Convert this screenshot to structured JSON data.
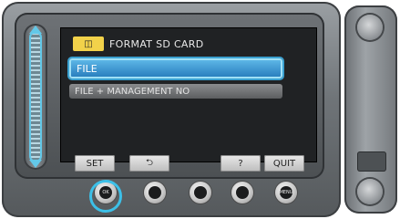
{
  "menu": {
    "title": "FORMAT SD CARD",
    "title_icon": "card-menu-icon",
    "items": [
      {
        "label": "FILE",
        "selected": true
      },
      {
        "label": "FILE + MANAGEMENT NO",
        "selected": false
      }
    ]
  },
  "softkeys": [
    {
      "label": "SET"
    },
    {
      "label": "⮌"
    },
    {
      "label": "?"
    },
    {
      "label": "QUIT"
    }
  ],
  "buttons": {
    "ok_label": "OK",
    "menu_label": "MENU"
  },
  "colors": {
    "highlight": "#3aa0cf",
    "title_icon_bg": "#f2d24a",
    "screen_bg": "#202224"
  }
}
